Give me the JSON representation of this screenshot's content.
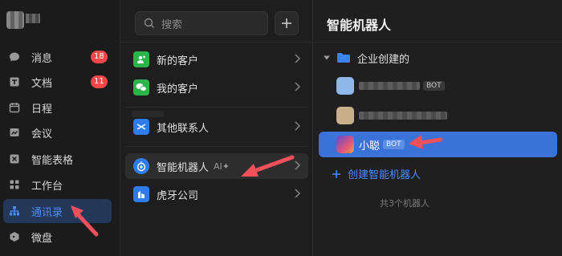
{
  "nav": {
    "items": [
      {
        "label": "消息",
        "icon": "chat-bubble-icon",
        "badge": "18"
      },
      {
        "label": "文档",
        "icon": "document-icon",
        "badge": "11"
      },
      {
        "label": "日程",
        "icon": "calendar-icon"
      },
      {
        "label": "会议",
        "icon": "video-icon"
      },
      {
        "label": "智能表格",
        "icon": "smart-table-icon"
      },
      {
        "label": "工作台",
        "icon": "workbench-icon"
      },
      {
        "label": "通讯录",
        "icon": "contacts-icon",
        "active": true
      },
      {
        "label": "微盘",
        "icon": "drive-icon"
      }
    ]
  },
  "middle": {
    "search_placeholder": "搜索",
    "items": [
      {
        "label": "新的客户",
        "icon": "new-customer-icon",
        "color": "#2bb44a"
      },
      {
        "label": "我的客户",
        "icon": "wechat-icon",
        "color": "#2bb44a"
      },
      {
        "label": "其他联系人",
        "icon": "other-contacts-icon",
        "color": "#2f7bea"
      },
      {
        "label": "智能机器人",
        "suffix": "AI✦",
        "icon": "robot-icon",
        "color": "#2f7bea",
        "active": true
      },
      {
        "label": "虎牙公司",
        "icon": "company-icon",
        "color": "#2f7bea"
      }
    ]
  },
  "right": {
    "title": "智能机器人",
    "folder": "企业创建的",
    "bots": [
      {
        "name": "",
        "tag": "BOT",
        "avatar": "#8fb8e8"
      },
      {
        "name": "",
        "tag": "",
        "avatar": "#c8b08a"
      },
      {
        "name": "小聪",
        "tag": "BOT",
        "avatar": "#7a6bd8",
        "selected": true
      }
    ],
    "create_label": "创建智能机器人",
    "count_text": "共3个机器人"
  },
  "colors": {
    "accent": "#4c8dff",
    "selected": "#3a72d8",
    "badge": "#f04848",
    "arrow": "#f0505a"
  }
}
